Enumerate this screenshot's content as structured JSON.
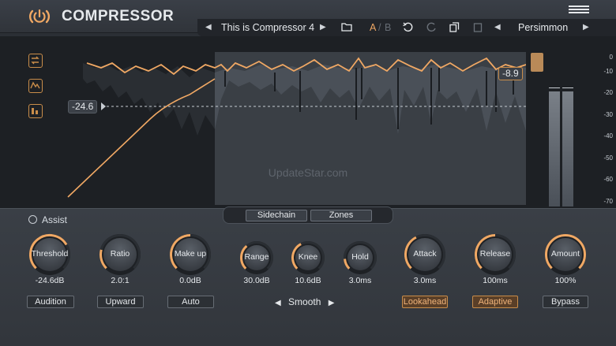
{
  "app": {
    "title": "COMPRESSOR",
    "accent_color": "#f0a864",
    "icons": [
      "power-icon",
      "menu-icon"
    ]
  },
  "preset_bar": {
    "preset_name": "This is Compressor 4",
    "ab_a": "A",
    "ab_sep": "/",
    "ab_b": "B",
    "style_name": "Persimmon",
    "icons": [
      "prev-arrow-icon",
      "next-arrow-icon",
      "folder-icon",
      "undo-icon",
      "redo-icon",
      "copy-icon",
      "paste-icon"
    ]
  },
  "display": {
    "threshold_badge": "-24.6",
    "gain_reduction_badge": "-8.9",
    "watermark": "UpdateStar.com",
    "meter_scale": [
      "0",
      "-10",
      "-20",
      "-30",
      "-40",
      "-50",
      "-60",
      "-70"
    ],
    "side_icons": [
      "loop-icon",
      "waveform-icon",
      "meter-icon"
    ]
  },
  "tabs": {
    "sidechain": "Sidechain",
    "zones": "Zones"
  },
  "assist": {
    "label": "Assist"
  },
  "knobs": [
    {
      "key": "threshold",
      "label": "Threshold",
      "value": "-24.6dB",
      "level": 0.72
    },
    {
      "key": "ratio",
      "label": "Ratio",
      "value": "2.0:1",
      "level": 0.22
    },
    {
      "key": "makeup",
      "label": "Make up",
      "value": "0.0dB",
      "level": 0.5
    },
    {
      "key": "range",
      "label": "Range",
      "value": "30.0dB",
      "level": 0.35
    },
    {
      "key": "knee",
      "label": "Knee",
      "value": "10.6dB",
      "level": 0.4
    },
    {
      "key": "hold",
      "label": "Hold",
      "value": "3.0ms",
      "level": 0.15
    },
    {
      "key": "attack",
      "label": "Attack",
      "value": "3.0ms",
      "level": 0.4
    },
    {
      "key": "release",
      "label": "Release",
      "value": "100ms",
      "level": 0.5
    },
    {
      "key": "amount",
      "label": "Amount",
      "value": "100%",
      "level": 1.0
    }
  ],
  "buttons": {
    "audition": "Audition",
    "upward": "Upward",
    "auto": "Auto",
    "smooth": "Smooth",
    "lookahead": "Lookahead",
    "adaptive": "Adaptive",
    "bypass": "Bypass"
  }
}
